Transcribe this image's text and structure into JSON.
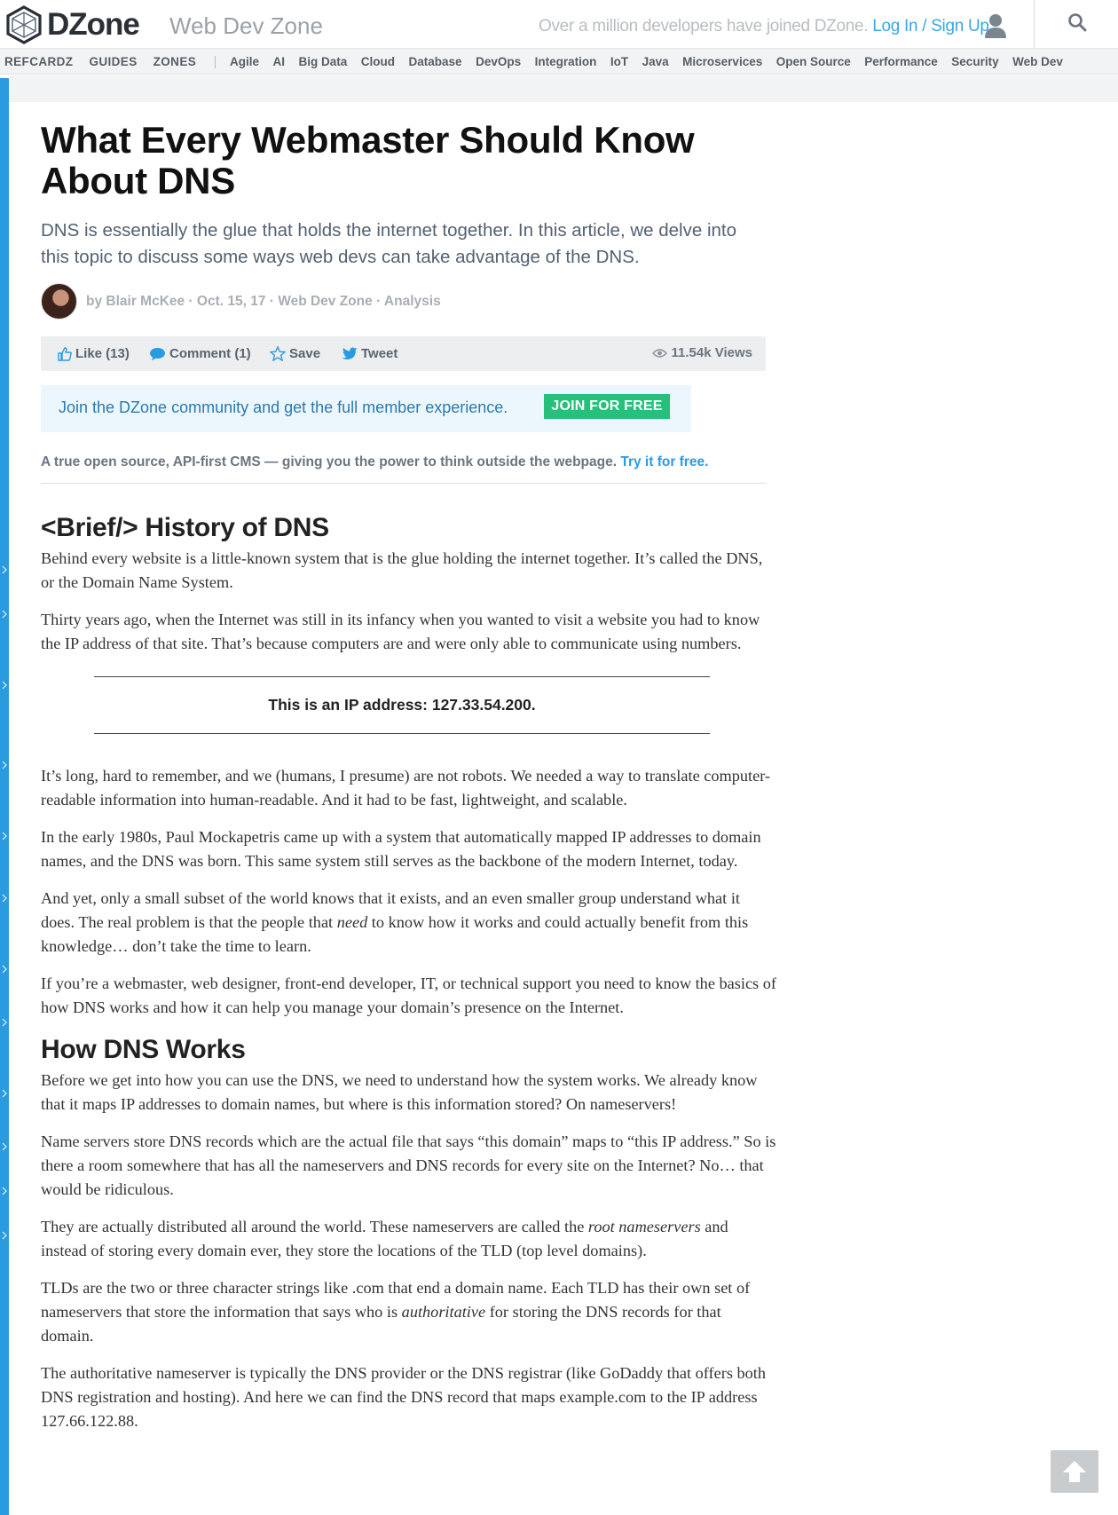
{
  "header": {
    "logo_text": "DZone",
    "zone_title": "Web Dev Zone",
    "tagline": "Over a million developers have joined DZone.",
    "login_label": "Log In",
    "auth_sep": " / ",
    "signup_label": "Sign Up"
  },
  "nav": {
    "main": [
      "REFCARDZ",
      "GUIDES",
      "ZONES"
    ],
    "zones": [
      "Agile",
      "AI",
      "Big Data",
      "Cloud",
      "Database",
      "DevOps",
      "Integration",
      "IoT",
      "Java",
      "Microservices",
      "Open Source",
      "Performance",
      "Security",
      "Web Dev"
    ]
  },
  "article": {
    "title": "What Every Webmaster Should Know About DNS",
    "subtitle": "DNS is essentially the glue that holds the internet together. In this article, we delve into this topic to discuss some ways web devs can take advantage of the DNS.",
    "byline": "by Blair McKee · Oct. 15, 17 · Web Dev Zone · Analysis",
    "actions": {
      "like": "Like (13)",
      "comment": "Comment (1)",
      "save": "Save",
      "tweet": "Tweet",
      "views": "11.54k Views"
    },
    "join": {
      "text": "Join the DZone community and get the full member experience.",
      "button": "JOIN FOR FREE"
    },
    "promo": {
      "text": "A true open source, API-first CMS — giving you the power to think outside the webpage.",
      "link": "Try it for free."
    },
    "sections": {
      "h_history": "<Brief/> History of DNS",
      "p1": "Behind every website is a little-known system that is the glue holding the internet together. It’s called the DNS, or the Domain Name System.",
      "p2": "Thirty years ago, when the Internet was still in its infancy when you wanted to visit a website you had to know the IP address of that site. That’s because computers are and were only able to communicate using numbers.",
      "callout": "This is an IP address: 127.33.54.200.",
      "p3": "It’s long, hard to remember, and we (humans, I presume) are not robots. We needed a way to translate computer-readable information into human-readable. And it had to be fast, lightweight, and scalable.",
      "p4": "In the early 1980s, Paul Mockapetris came up with a system that automatically mapped IP addresses to domain names, and the DNS was born. This same system still serves as the backbone of the modern Internet, today.",
      "p5a": "And yet, only a small subset of the world knows that it exists, and an even smaller group understand what it does. The real problem is that the people that ",
      "p5em": "need",
      "p5b": " to know how it works and could actually benefit from this knowledge… don’t take the time to learn.",
      "p6": "If you’re a webmaster, web designer, front-end developer, IT, or technical support you need to know the basics of how DNS works and how it can help you manage your domain’s presence on the Internet.",
      "h_how": "How DNS Works",
      "p7": "Before we get into how you can use the DNS, we need to understand how the system works. We already know that it maps IP addresses to domain names, but where is this information stored? On nameservers!",
      "p8": "Name servers store DNS records which are the actual file that says “this domain” maps to “this IP address.” So is there a room somewhere that has all the nameservers and DNS records for every site on the Internet? No… that would be ridiculous.",
      "p9a": "They are actually distributed all around the world. These nameservers are called the ",
      "p9em": "root nameservers",
      "p9b": " and instead of storing every domain ever, they store the locations of the TLD (top level domains).",
      "p10a": "TLDs are the two or three character strings like .com that end a domain name. Each TLD has their own set of nameservers that store the information that says who is ",
      "p10em": "authoritative",
      "p10b": " for storing the DNS records for that domain.",
      "p11": "The authoritative nameserver is typically the DNS provider or the DNS registrar (like GoDaddy that offers both DNS registration and hosting). And here we can find the DNS record that maps example.com to the IP address 127.66.122.88."
    }
  },
  "icons": {
    "logo": "dzone-logo-icon",
    "user": "user-icon",
    "search": "search-icon",
    "like": "thumbs-up-icon",
    "comment": "comment-bubble-icon",
    "save": "star-icon",
    "tweet": "twitter-bird-icon",
    "views": "eye-icon",
    "scroll_top": "arrow-up-icon"
  },
  "colors": {
    "accent": "#2b9be0",
    "join_button": "#25c17c",
    "text_dark": "#111111"
  }
}
